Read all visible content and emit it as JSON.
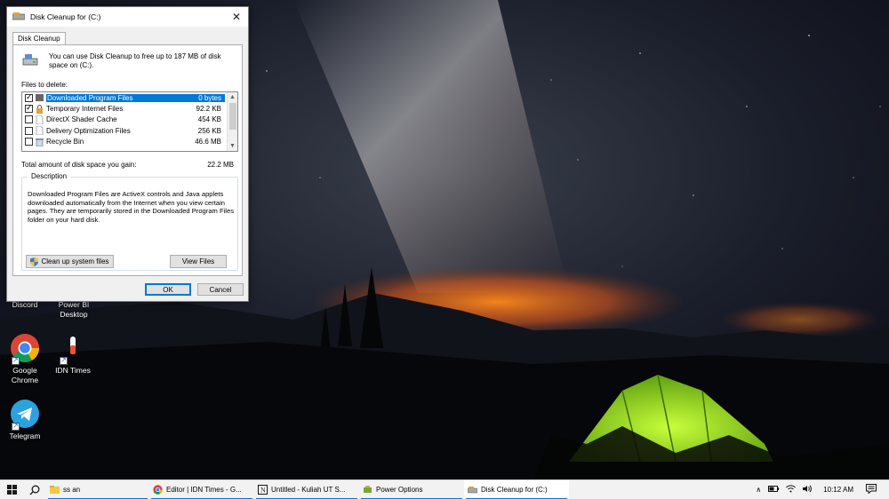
{
  "dialog": {
    "title": "Disk Cleanup for  (C:)",
    "tab": "Disk Cleanup",
    "intro": "You can use Disk Cleanup to free up to 187 MB of disk space on  (C:).",
    "files_label": "Files to delete:",
    "files": [
      {
        "name": "Downloaded Program Files",
        "size": "0 bytes",
        "checked": true,
        "selected": true
      },
      {
        "name": "Temporary Internet Files",
        "size": "92.2 KB",
        "checked": true,
        "selected": false
      },
      {
        "name": "DirectX Shader Cache",
        "size": "454 KB",
        "checked": false,
        "selected": false
      },
      {
        "name": "Delivery Optimization Files",
        "size": "256 KB",
        "checked": false,
        "selected": false
      },
      {
        "name": "Recycle Bin",
        "size": "46.6 MB",
        "checked": false,
        "selected": false
      }
    ],
    "total_label": "Total amount of disk space you gain:",
    "total_value": "22.2 MB",
    "description_legend": "Description",
    "description_text": "Downloaded Program Files are ActiveX controls and Java applets downloaded automatically from the Internet when you view certain pages. They are temporarily stored in the Downloaded Program Files folder on your hard disk.",
    "cleanup_system_label": "Clean up system files",
    "view_files_label": "View Files",
    "ok_label": "OK",
    "cancel_label": "Cancel"
  },
  "desktop": {
    "icons": [
      {
        "label": "Discord"
      },
      {
        "label": "Power BI Desktop"
      },
      {
        "label": "Google Chrome"
      },
      {
        "label": "IDN Times"
      },
      {
        "label": "Telegram"
      }
    ]
  },
  "taskbar": {
    "items": [
      {
        "label": "ss an"
      },
      {
        "label": "Editor | IDN Times - G..."
      },
      {
        "label": "Untitled - Kuliah UT S..."
      },
      {
        "label": "Power Options"
      },
      {
        "label": "Disk Cleanup for  (C:)"
      }
    ],
    "time": "10:12 AM"
  },
  "colors": {
    "accent": "#0078d7",
    "dialog_bg": "#f0f0f0",
    "taskbar_bg": "#f2f2f2"
  },
  "icons": [
    "windows-start-icon",
    "search-icon",
    "folder-icon",
    "chrome-icon",
    "notion-icon",
    "power-options-icon",
    "disk-cleanup-icon",
    "chevron-up-icon",
    "battery-icon",
    "network-icon",
    "volume-icon",
    "notification-icon",
    "shield-icon",
    "close-icon"
  ]
}
